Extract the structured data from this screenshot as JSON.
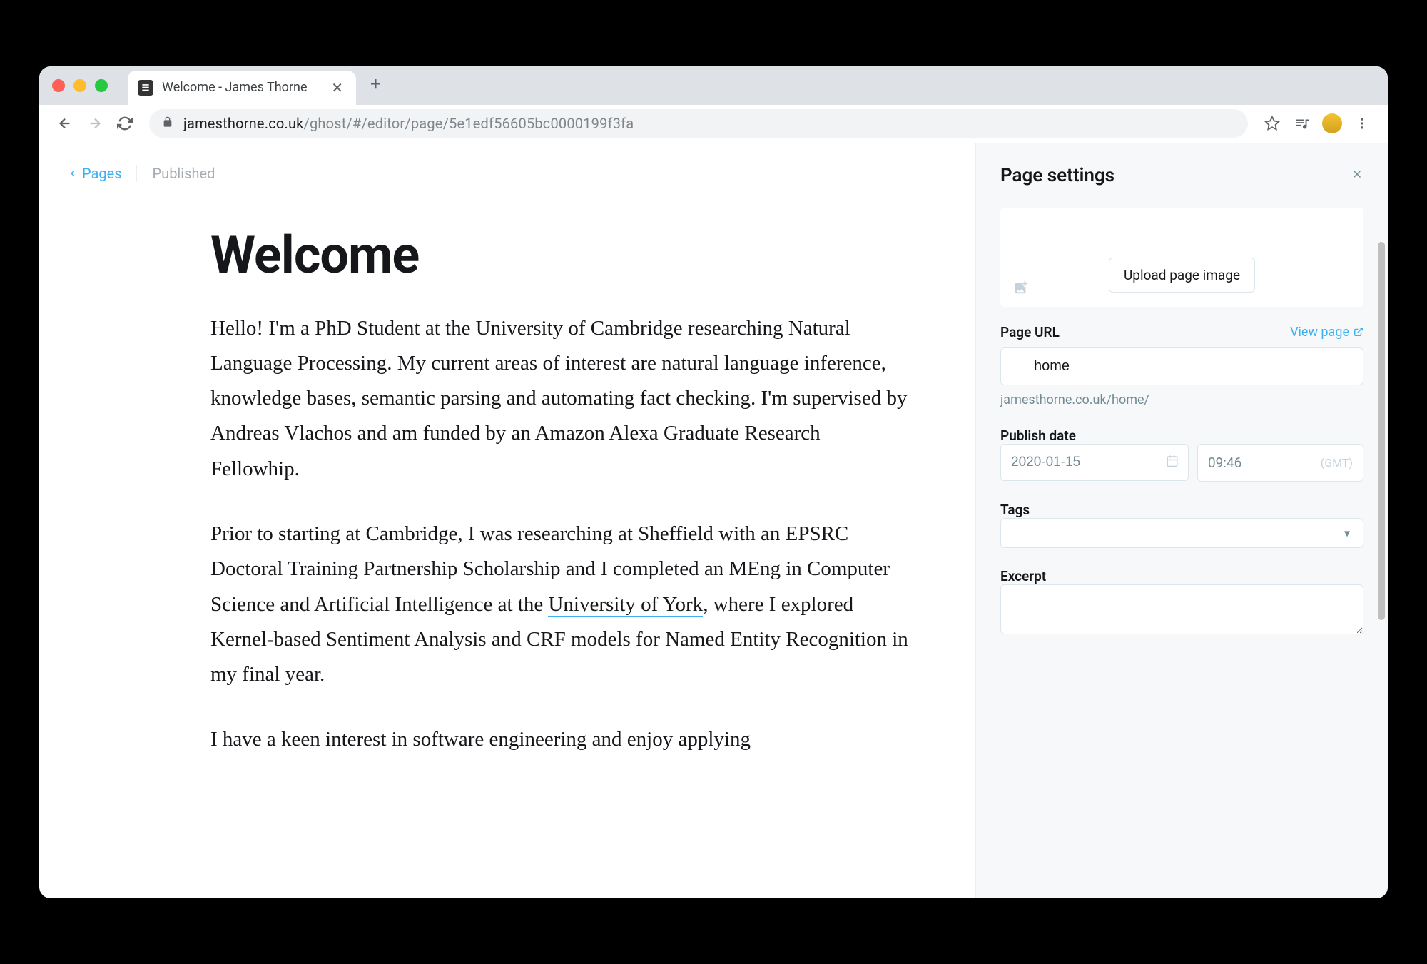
{
  "browser": {
    "tab_title": "Welcome - James Thorne",
    "url_domain": "jamesthorne.co.uk",
    "url_path": "/ghost/#/editor/page/5e1edf56605bc0000199f3fa"
  },
  "editor": {
    "back_label": "Pages",
    "status": "Published",
    "title": "Welcome",
    "para1_a": "Hello! I'm a PhD Student at the ",
    "para1_link1": "University of Cambridge",
    "para1_b": " researching Natural Language Processing. My current areas of interest are natural language inference, knowledge bases, semantic parsing and automating ",
    "para1_link2": "fact checking",
    "para1_c": ". I'm supervised by ",
    "para1_link3": "Andreas Vlachos",
    "para1_d": " and am funded by an Amazon Alexa Graduate Research Fellowhip.",
    "para2_a": "Prior to starting at Cambridge, I was researching at Sheffield with an EPSRC Doctoral Training Partnership Scholarship and I completed an MEng in Computer Science and Artificial Intelligence at the ",
    "para2_link1": "University of York",
    "para2_b": ", where I explored Kernel-based Sentiment Analysis and CRF models for Named Entity Recognition in my final year.",
    "para3": "I have a keen interest in software engineering and enjoy applying"
  },
  "settings": {
    "title": "Page settings",
    "upload_button": "Upload page image",
    "url_label": "Page URL",
    "view_page": "View page",
    "url_value": "home",
    "url_preview": "jamesthorne.co.uk/home/",
    "date_label": "Publish date",
    "date_value": "2020-01-15",
    "time_value": "09:46",
    "tz": "(GMT)",
    "tags_label": "Tags",
    "excerpt_label": "Excerpt"
  }
}
